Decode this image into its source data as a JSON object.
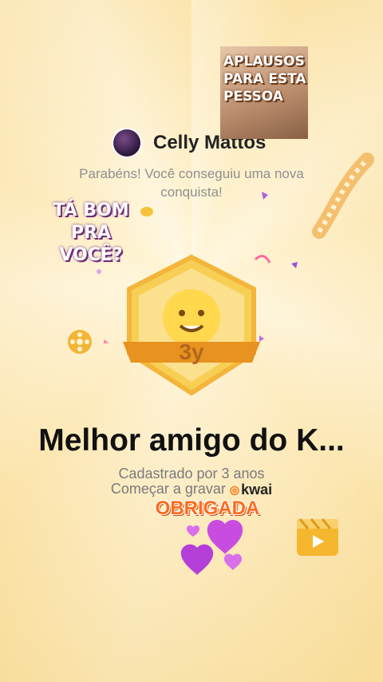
{
  "user": {
    "name": "Celly Mattos"
  },
  "message": {
    "congrats_line1": "Parabéns! Você conseguiu uma nova",
    "congrats_line2": "conquista!"
  },
  "stickers": {
    "top_right_lines": [
      "APLAUSOS",
      "PARA ESTA",
      "PESSOA"
    ],
    "left_lines": [
      "TÁ BOM",
      "PRA VOCÊ?"
    ]
  },
  "achievement": {
    "badge_label": "3y",
    "title": "Melhor amigo do K...",
    "subtitle": "Cadastrado por 3 anos",
    "record_label": "Começar a gravar",
    "brand": "kwai"
  },
  "obrigada": "OBRIGADA",
  "colors": {
    "accent_orange": "#ff6a1a",
    "badge_gold": "#f6c444",
    "heart_purple": "#c94ce0"
  },
  "icons": [
    "avatar",
    "achievement-badge",
    "film-reel-icon",
    "clapperboard-icon",
    "hearts-sticker"
  ]
}
